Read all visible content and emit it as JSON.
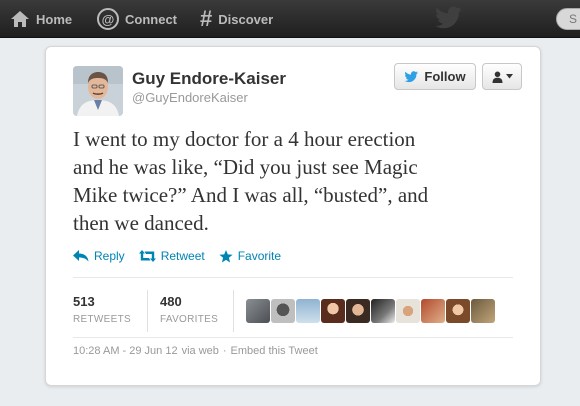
{
  "nav": {
    "home_label": "Home",
    "connect_label": "Connect",
    "discover_label": "Discover",
    "search_initial": "S"
  },
  "tweet": {
    "author_name": "Guy Endore-Kaiser",
    "author_handle": "@GuyEndoreKaiser",
    "follow_label": "Follow",
    "text_line1": "I went to my doctor for a 4 hour erection",
    "text_line2": "and he was like, “Did you just see Magic",
    "text_line3": "Mike twice?” And I was all, “busted”, and",
    "text_line4": "then we danced.",
    "actions": {
      "reply": "Reply",
      "retweet": "Retweet",
      "favorite": "Favorite"
    },
    "stats": {
      "retweets_count": "513",
      "retweets_label": "RETWEETS",
      "favorites_count": "480",
      "favorites_label": "FAVORITES"
    },
    "meta": {
      "timestamp": "10:28 AM - 29 Jun 12",
      "via": "via web",
      "separator": "·",
      "embed": "Embed this Tweet"
    }
  },
  "colors": {
    "link": "#0084b4",
    "twitter_blue": "#2ea0e6",
    "topbar": "#2a2a2a"
  },
  "icons": [
    "home-icon",
    "at-icon",
    "hash-icon",
    "bird-icon",
    "reply-icon",
    "retweet-icon",
    "star-icon",
    "user-icon"
  ]
}
